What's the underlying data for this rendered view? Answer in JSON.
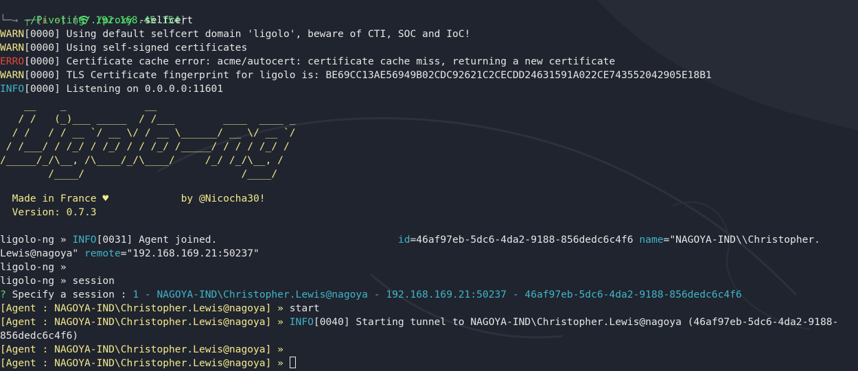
{
  "prompt": {
    "bracket_open": "┌─[",
    "arrow": "▸",
    "tilde": "~",
    "mid": "] [",
    "ip": "192.168.45.154",
    "close": "]",
    "continue": "└─→ ",
    "path": "~/Pivoting/./proxy",
    "args": " -selfcert"
  },
  "log": [
    {
      "level": "WARN",
      "level_color": "#f2e98d",
      "rest": "[0000] Using default selfcert domain 'ligolo', beware of CTI, SOC and IoC!"
    },
    {
      "level": "WARN",
      "level_color": "#f2e98d",
      "rest": "[0000] Using self-signed certificates"
    },
    {
      "level": "ERRO",
      "level_color": "#e5473e",
      "rest": "[0000] Certificate cache error: acme/autocert: certificate cache miss, returning a new certificate"
    },
    {
      "level": "WARN",
      "level_color": "#f2e98d",
      "rest": "[0000] TLS Certificate fingerprint for ligolo is: BE69CC13AE56949B02CDC92621C2CECDD24631591A022CE743552042905E18B1"
    },
    {
      "level": "INFO",
      "level_color": "#3fb5c9",
      "rest": "[0000] Listening on 0.0.0.0:11601"
    }
  ],
  "banner": [
    "    __    _             __                       ",
    "   / /   (_)___ _____  / /___        ____  ____ _",
    "  / /   / / __ `/ __ \\/ / __ \\______/ __ \\/ __ `/",
    " / /___/ / /_/ / /_/ / / /_/ /_____/ / / / /_/ / ",
    "/_____/_/\\__, /\\____/_/\\____/     /_/ /_/\\__, /  ",
    "        /____/                          /____/   "
  ],
  "made_in": "  Made in France ♥            by @Nicocha30!",
  "version": "  Version: 0.7.3",
  "ligolo_prompt": "ligolo-ng » ",
  "agent_joined": {
    "level": "INFO",
    "tag": "[0031] Agent joined.",
    "pad": "                              ",
    "id_key": "id",
    "id_val": "=46af97eb-5dc6-4da2-9188-856dedc6c4f6 ",
    "name_key": "name",
    "name_val": "=\"NAGOYA-IND\\\\Christopher.",
    "cont": "Lewis@nagoya\" ",
    "remote_key": "remote",
    "remote_val": "=\"192.168.169.21:50237\""
  },
  "session_cmd": "session",
  "question": {
    "mark": "? ",
    "label": "Specify a session : ",
    "value": "1 - NAGOYA-IND\\Christopher.Lewis@nagoya - 192.168.169.21:50237 - 46af97eb-5dc6-4da2-9188-856dedc6c4f6"
  },
  "agent_prompt": "[Agent : NAGOYA-IND\\Christopher.Lewis@nagoya] » ",
  "start_cmd": "start",
  "tunnel": {
    "level": "INFO",
    "rest": "[0040] Starting tunnel to NAGOYA-IND\\Christopher.Lewis@nagoya (46af97eb-5dc6-4da2-9188-",
    "cont": "856dedc6c4f6)"
  },
  "colors": {
    "background": "#20242e",
    "prompt_gray": "#8a8f99",
    "red": "#e5473e",
    "green": "#52e36b",
    "cyan": "#3fb5c9",
    "yellow": "#f2e98d",
    "text": "#ececec"
  },
  "icons": [
    "wifi-icon",
    "terminal-cursor"
  ]
}
